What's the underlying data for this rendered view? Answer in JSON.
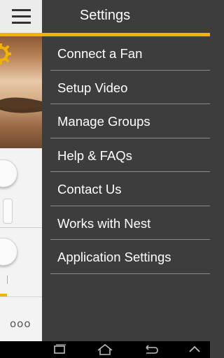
{
  "drawer": {
    "title": "Settings",
    "items": [
      {
        "label": "Connect a Fan"
      },
      {
        "label": "Setup Video"
      },
      {
        "label": "Manage Groups"
      },
      {
        "label": "Help & FAQs"
      },
      {
        "label": "Contact Us"
      },
      {
        "label": "Works with Nest"
      },
      {
        "label": "Application Settings"
      }
    ]
  },
  "left_panel": {
    "more_label": "ooo"
  },
  "icons": {
    "menu": "hamburger-icon",
    "settings": "gear-icon",
    "recent": "recent-apps-icon",
    "home": "home-icon",
    "back": "back-icon",
    "up": "chevron-up-icon"
  },
  "colors": {
    "accent": "#f2b300",
    "drawer_bg": "#3d3d3d",
    "panel_bg": "#f3f3f3"
  }
}
